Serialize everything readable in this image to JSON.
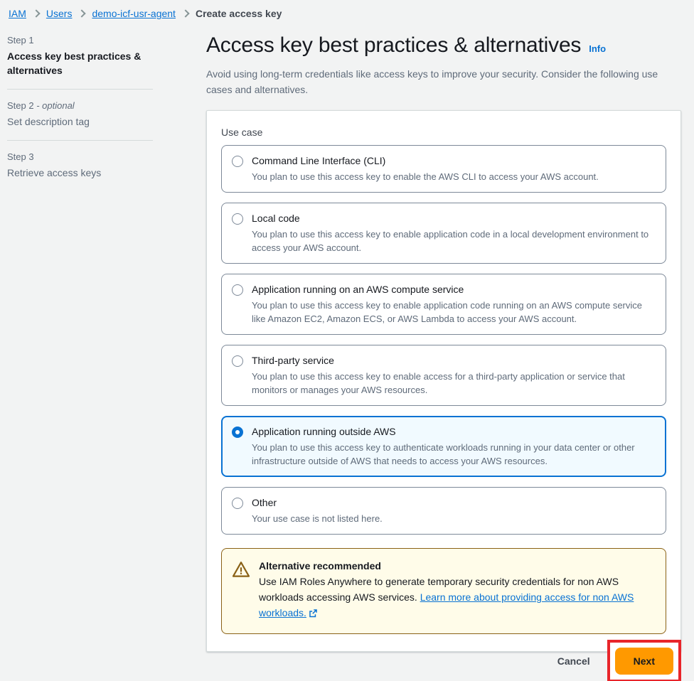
{
  "breadcrumb": {
    "items": [
      {
        "label": "IAM",
        "type": "link"
      },
      {
        "label": "Users",
        "type": "link"
      },
      {
        "label": "demo-icf-usr-agent",
        "type": "link"
      },
      {
        "label": "Create access key",
        "type": "current"
      }
    ]
  },
  "steps": [
    {
      "number": "Step 1",
      "optional": "",
      "title": "Access key best practices & alternatives",
      "active": true
    },
    {
      "number": "Step 2",
      "optional": " - optional",
      "title": "Set description tag",
      "active": false
    },
    {
      "number": "Step 3",
      "optional": "",
      "title": "Retrieve access keys",
      "active": false
    }
  ],
  "header": {
    "title": "Access key best practices & alternatives",
    "info_label": "Info",
    "description": "Avoid using long-term credentials like access keys to improve your security. Consider the following use cases and alternatives."
  },
  "form": {
    "use_case_label": "Use case",
    "options": [
      {
        "title": "Command Line Interface (CLI)",
        "description": "You plan to use this access key to enable the AWS CLI to access your AWS account.",
        "selected": false
      },
      {
        "title": "Local code",
        "description": "You plan to use this access key to enable application code in a local development environment to access your AWS account.",
        "selected": false
      },
      {
        "title": "Application running on an AWS compute service",
        "description": "You plan to use this access key to enable application code running on an AWS compute service like Amazon EC2, Amazon ECS, or AWS Lambda to access your AWS account.",
        "selected": false
      },
      {
        "title": "Third-party service",
        "description": "You plan to use this access key to enable access for a third-party application or service that monitors or manages your AWS resources.",
        "selected": false
      },
      {
        "title": "Application running outside AWS",
        "description": "You plan to use this access key to authenticate workloads running in your data center or other infrastructure outside of AWS that needs to access your AWS resources.",
        "selected": true
      },
      {
        "title": "Other",
        "description": "Your use case is not listed here.",
        "selected": false
      }
    ]
  },
  "alert": {
    "title": "Alternative recommended",
    "text_before": "Use IAM Roles Anywhere to generate temporary security credentials for non AWS workloads accessing AWS services. ",
    "link_text": "Learn more about providing access for non AWS workloads."
  },
  "footer": {
    "cancel_label": "Cancel",
    "next_label": "Next"
  },
  "colors": {
    "accent_blue": "#0972d3",
    "selected_background": "#f1faff",
    "warning_border": "#8a6116",
    "warning_background": "#fffce9",
    "next_button": "#ff9900",
    "highlight_annotation": "#e8252a",
    "page_background": "#f2f3f3"
  }
}
